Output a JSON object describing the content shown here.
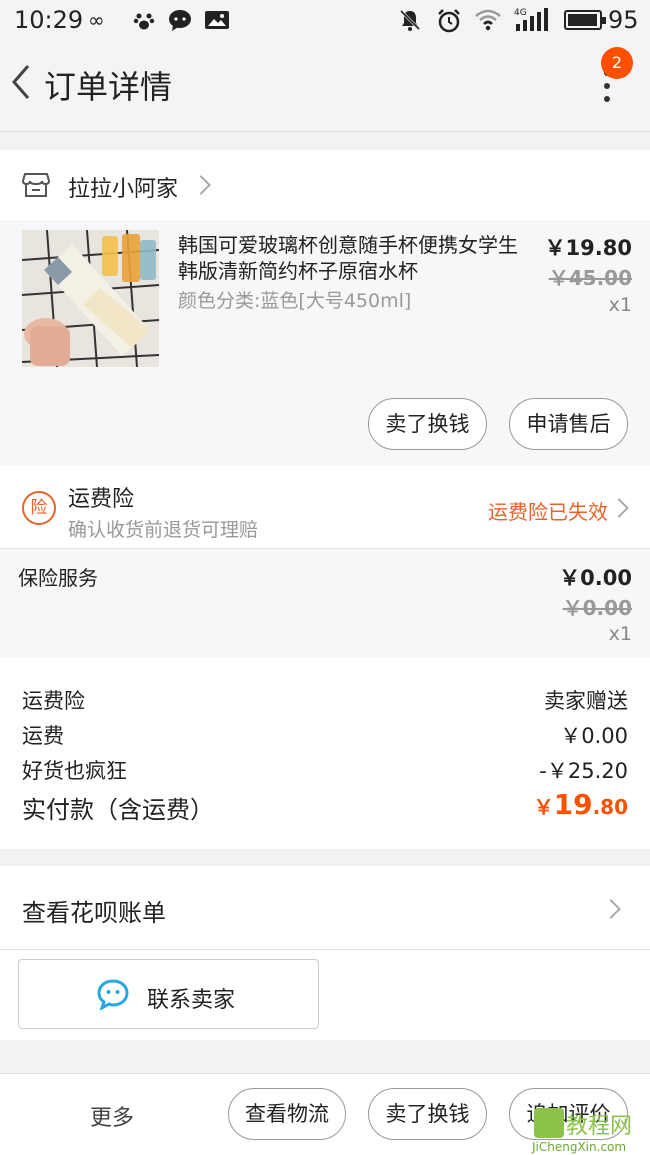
{
  "status_bar": {
    "time": "10:29",
    "network": "4G",
    "battery_percent": "95",
    "battery_level": 0.95
  },
  "header": {
    "title": "订单详情",
    "badge_count": "2"
  },
  "store": {
    "name": "拉拉小阿家"
  },
  "product": {
    "title": "韩国可爱玻璃杯创意随手杯便携女学生韩版清新简约杯子原宿水杯",
    "spec": "颜色分类:蓝色[大号450ml]",
    "price": "￥19.80",
    "original_price": "￥45.00",
    "quantity": "x1",
    "actions": [
      "卖了换钱",
      "申请售后"
    ]
  },
  "insurance": {
    "icon_char": "险",
    "title": "运费险",
    "subtitle": "确认收货前退货可理赔",
    "status": "运费险已失效"
  },
  "insurance_service": {
    "label": "保险服务",
    "price": "￥0.00",
    "original_price": "￥0.00",
    "quantity": "x1"
  },
  "summary": {
    "rows": [
      {
        "label": "运费险",
        "value": "卖家赠送"
      },
      {
        "label": "运费",
        "value": "￥0.00"
      },
      {
        "label": "好货也疯狂",
        "value": "-￥25.20"
      }
    ],
    "total_label": "实付款（含运费）",
    "total_currency": "￥",
    "total_integer": "19",
    "total_decimal": ".80"
  },
  "huabei": {
    "label": "查看花呗账单"
  },
  "contact": {
    "label": "联系卖家"
  },
  "bottom_bar": {
    "more": "更多",
    "buttons": [
      "查看物流",
      "卖了换钱",
      "追加评价"
    ]
  },
  "watermark": {
    "text": "教程网",
    "sub": "JiChengXin.com"
  },
  "colors": {
    "accent": "#ff5000",
    "insurance": "#e8632a",
    "watermark": "#8bc34a"
  }
}
